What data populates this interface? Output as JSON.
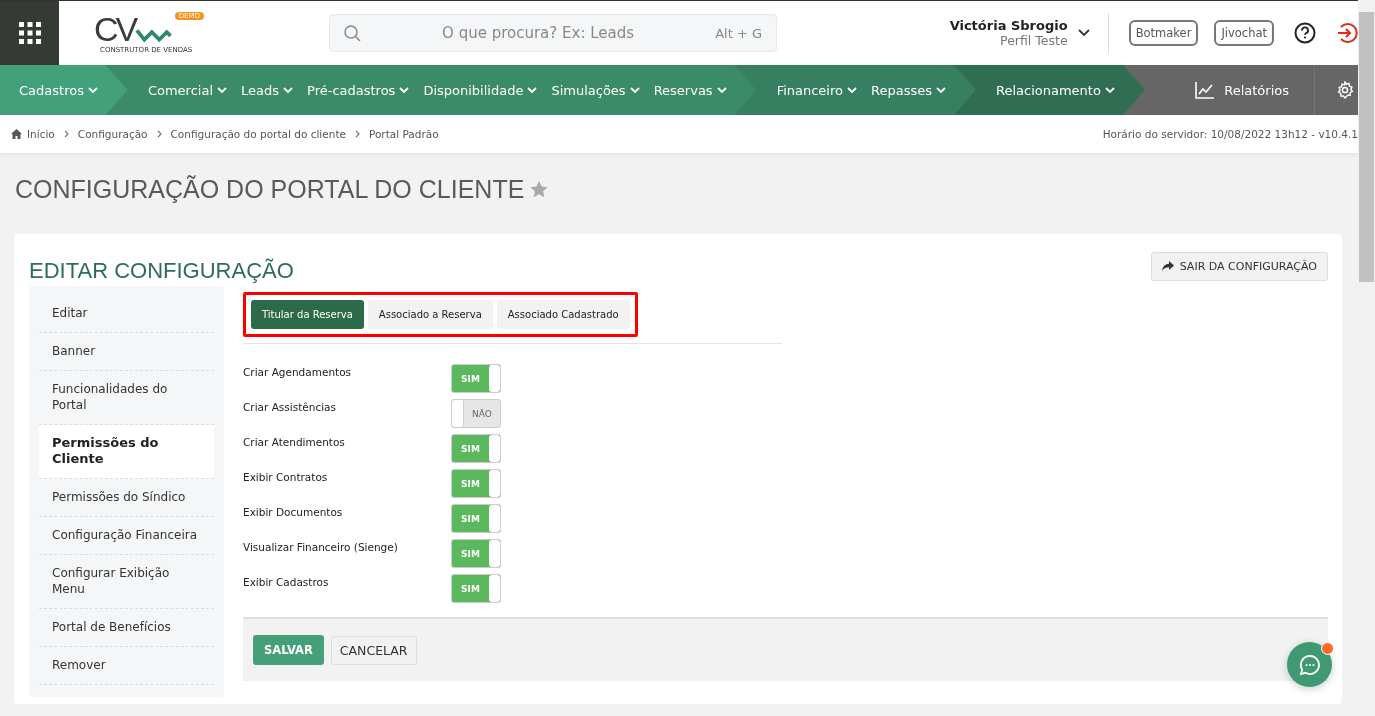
{
  "logo": {
    "mark": "CV",
    "badge": "DEMO",
    "tagline": "CONSTRUTOR DE VENDAS"
  },
  "search": {
    "placeholder": "O que procura? Ex: Leads",
    "shortcut": "Alt + G"
  },
  "user": {
    "name": "Victória Sbrogio",
    "profile": "Perfil Teste"
  },
  "top_buttons": [
    "Botmaker",
    "Jivochat"
  ],
  "nav": [
    {
      "color": "#42a07a",
      "items": [
        "Cadastros"
      ]
    },
    {
      "color": "#3b8b69",
      "items": [
        "Comercial",
        "Leads",
        "Pré-cadastros",
        "Disponibilidade",
        "Simulações",
        "Reservas"
      ]
    },
    {
      "color": "#367f60",
      "items": [
        "Financeiro",
        "Repasses"
      ]
    },
    {
      "color": "#2f6e53",
      "items": [
        "Relacionamento"
      ]
    }
  ],
  "reports": "Relatórios",
  "breadcrumb": [
    "Início",
    "Configuração",
    "Configuração do portal do cliente",
    "Portal Padrão"
  ],
  "server_time": "Horário do servidor: 10/08/2022 13h12 - v10.4.1",
  "page_title": "CONFIGURAÇÃO DO PORTAL DO CLIENTE",
  "card": {
    "title": "EDITAR CONFIGURAÇÃO",
    "exit_button": "SAIR DA CONFIGURAÇÃO",
    "sidebar": [
      {
        "label": "Editar",
        "selected": false
      },
      {
        "label": "Banner",
        "selected": false
      },
      {
        "label": "Funcionalidades do Portal",
        "selected": false
      },
      {
        "label": "Permissões do Cliente",
        "selected": true
      },
      {
        "label": "Permissões do Síndico",
        "selected": false
      },
      {
        "label": "Configuração Financeira",
        "selected": false
      },
      {
        "label": "Configurar Exibição Menu",
        "selected": false
      },
      {
        "label": "Portal de Benefícios",
        "selected": false
      },
      {
        "label": "Remover",
        "selected": false
      }
    ],
    "tabs": [
      {
        "label": "Titular da Reserva",
        "selected": true
      },
      {
        "label": "Associado a Reserva",
        "selected": false
      },
      {
        "label": "Associado Cadastrado",
        "selected": false
      }
    ],
    "settings": [
      {
        "label": "Criar Agendamentos",
        "on": true,
        "toggle_text": "SIM"
      },
      {
        "label": "Criar Assistências",
        "on": false,
        "toggle_text": "NÃO"
      },
      {
        "label": "Criar Atendimentos",
        "on": true,
        "toggle_text": "SIM"
      },
      {
        "label": "Exibir Contratos",
        "on": true,
        "toggle_text": "SIM"
      },
      {
        "label": "Exibir Documentos",
        "on": true,
        "toggle_text": "SIM"
      },
      {
        "label": "Visualizar Financeiro (Sienge)",
        "on": true,
        "toggle_text": "SIM"
      },
      {
        "label": "Exibir Cadastros",
        "on": true,
        "toggle_text": "SIM"
      }
    ],
    "actions": {
      "save": "SALVAR",
      "cancel": "CANCELAR"
    }
  }
}
